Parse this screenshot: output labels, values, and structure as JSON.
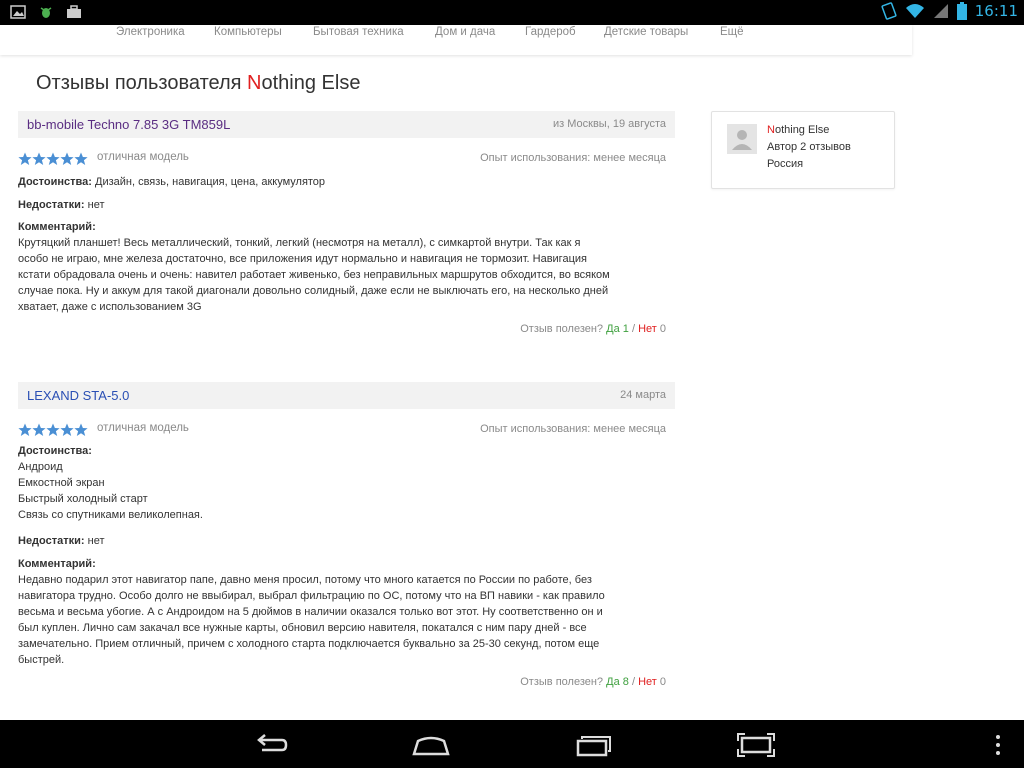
{
  "status_bar": {
    "time": "16:11",
    "left_icons": [
      "image-icon",
      "bug-icon",
      "briefcase-icon"
    ],
    "right_icons": [
      "screen-rotate-icon",
      "wifi-icon",
      "signal-icon",
      "battery-icon"
    ]
  },
  "categories": [
    "Электроника",
    "Компьютеры",
    "Бытовая техника",
    "Дом и дача",
    "Гардероб",
    "Детские товары",
    "Ещё"
  ],
  "page": {
    "title_prefix": "Отзывы пользователя ",
    "title_user_first": "N",
    "title_user_rest": "othing Else"
  },
  "labels": {
    "pros": "Достоинства:",
    "cons": "Недостатки:",
    "comment": "Комментарий:",
    "helpful": "Отзыв полезен?",
    "yes": "Да",
    "no": "Нет",
    "sep": "/"
  },
  "reviews": [
    {
      "product": "bb-mobile Techno 7.85 3G TM859L",
      "meta": "из Москвы, 19 августа",
      "rating": 5,
      "rating_text": "отличная модель",
      "usage": "Опыт использования: менее месяца",
      "pros": "Дизайн, связь, навигация, цена, аккумулятор",
      "cons": "нет",
      "comment_lines": [
        "Крутяцкий планшет! Весь металлический, тонкий, легкий (несмотря на металл), с симкартой внутри. Так как я",
        "особо не играю, мне железа достаточно, все приложения идут нормально и навигация не тормозит. Навигация",
        "кстати обрадовала очень и очень: навител работает живенько, без неправильных маршрутов обходится, во всяком",
        "случае пока. Ну и аккум для такой диагонали довольно солидный, даже если не выключать его, на несколько дней",
        "хватает, даже с использованием 3G"
      ],
      "helpful_yes": "1",
      "helpful_no": "0"
    },
    {
      "product": "LEXAND STA-5.0",
      "meta": "24 марта",
      "rating": 5,
      "rating_text": "отличная модель",
      "usage": "Опыт использования: менее месяца",
      "pros_lines": [
        "Андроид",
        "Емкостной экран",
        "Быстрый холодный старт",
        "Связь со спутниками великолепная."
      ],
      "cons": "нет",
      "comment_lines": [
        "Недавно подарил этот навигатор папе, давно меня просил, потому что много катается по России по работе, без",
        "навигатора трудно. Особо долго не ввыбирал, выбрал фильтрацию по ОС, потому что на ВП навики - как правило",
        "весьма и весьма убогие. А с Андроидом на 5 дюймов в наличии оказался только вот этот. Ну соответственно он и",
        "был куплен. Лично сам закачал все нужные карты, обновил версию навителя, покатался с ним пару дней - все",
        "замечательно. Прием отличный, причем с холодного старта подключается буквально за 25-30 секунд, потом еще",
        "быстрей."
      ],
      "helpful_yes": "8",
      "helpful_no": "0"
    }
  ],
  "author_card": {
    "name_first": "N",
    "name_rest": "othing Else",
    "reviews_count": "Автор 2 отзывов",
    "country": "Россия"
  },
  "colors": {
    "accent_red": "#e02020",
    "product_link_1": "#5a2d82",
    "product_link_2": "#2a4fb4",
    "yes_green": "#3fa03f",
    "star_blue": "#4a8fd4",
    "time_blue": "#33b5e5"
  },
  "nav_bar": {
    "buttons": [
      "back-icon",
      "home-icon",
      "recents-icon",
      "screenshot-icon",
      "menu-icon"
    ]
  }
}
